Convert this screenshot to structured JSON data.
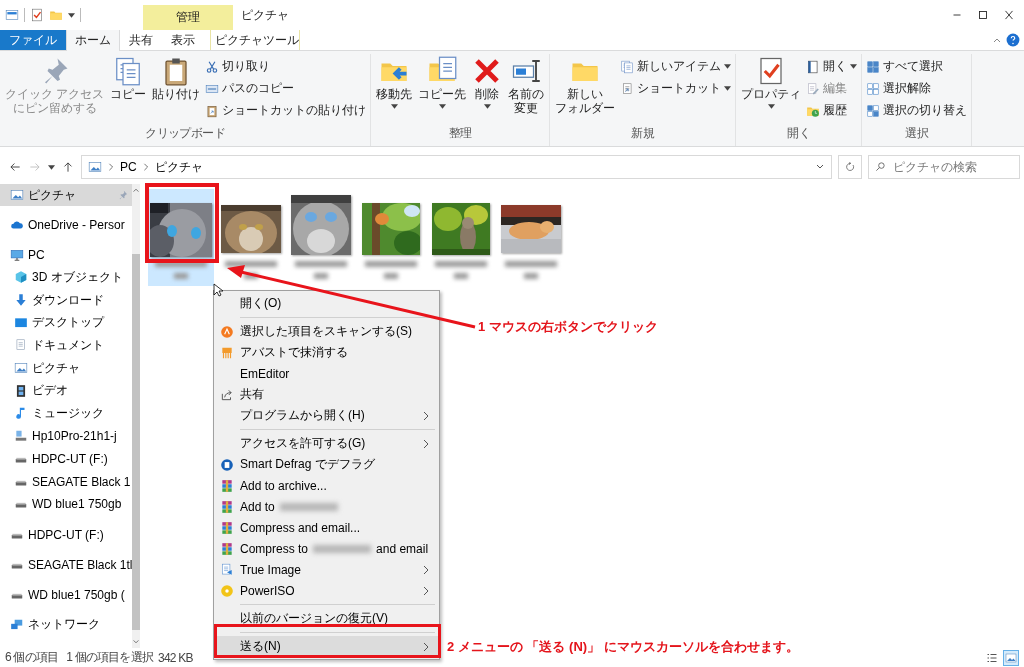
{
  "title_bar": {
    "contextual_tab_group": "管理",
    "title": "ピクチャ"
  },
  "ribbon_tabs": [
    {
      "label": "ファイル",
      "kind": "file",
      "selected": false
    },
    {
      "label": "ホーム",
      "kind": "normal",
      "selected": true
    },
    {
      "label": "共有",
      "kind": "normal",
      "selected": false
    },
    {
      "label": "表示",
      "kind": "normal",
      "selected": false
    },
    {
      "label": "ピクチャツール",
      "kind": "contextual",
      "selected": false
    }
  ],
  "ribbon_groups": [
    {
      "name": "クリップボード",
      "commands": [
        {
          "lines": [
            "クイック アクセス",
            "にピン留めする"
          ],
          "kind": "large",
          "dropdown": false,
          "disabled": true
        },
        {
          "label": "コピー",
          "kind": "large",
          "dropdown": false,
          "disabled": false
        },
        {
          "label": "貼り付け",
          "kind": "large",
          "dropdown": false,
          "disabled": false
        },
        {
          "label": "切り取り",
          "kind": "small",
          "dropdown": false,
          "disabled": false
        },
        {
          "label": "パスのコピー",
          "kind": "small",
          "dropdown": false,
          "disabled": false
        },
        {
          "label": "ショートカットの貼り付け",
          "kind": "small",
          "dropdown": false,
          "disabled": false
        }
      ]
    },
    {
      "name": "整理",
      "commands": [
        {
          "label": "移動先",
          "kind": "large",
          "dropdown": true,
          "disabled": false
        },
        {
          "label": "コピー先",
          "kind": "large",
          "dropdown": true,
          "disabled": false
        },
        {
          "label": "削除",
          "kind": "large",
          "dropdown": true,
          "disabled": false
        },
        {
          "lines": [
            "名前の",
            "変更"
          ],
          "kind": "large",
          "dropdown": false,
          "disabled": false
        }
      ]
    },
    {
      "name": "新規",
      "commands": [
        {
          "lines": [
            "新しい",
            "フォルダー"
          ],
          "kind": "large",
          "dropdown": false,
          "disabled": false
        },
        {
          "label": "新しいアイテム",
          "kind": "small",
          "dropdown": true,
          "disabled": false
        },
        {
          "label": "ショートカット",
          "kind": "small",
          "dropdown": true,
          "disabled": false
        }
      ]
    },
    {
      "name": "開く",
      "commands": [
        {
          "label": "プロパティ",
          "kind": "large",
          "dropdown": true,
          "disabled": false
        },
        {
          "label": "開く",
          "kind": "small",
          "dropdown": true,
          "disabled": false
        },
        {
          "label": "編集",
          "kind": "small",
          "dropdown": false,
          "disabled": true
        },
        {
          "label": "履歴",
          "kind": "small",
          "dropdown": false,
          "disabled": false
        }
      ]
    },
    {
      "name": "選択",
      "commands": [
        {
          "label": "すべて選択",
          "kind": "small",
          "dropdown": false,
          "disabled": false
        },
        {
          "label": "選択解除",
          "kind": "small",
          "dropdown": false,
          "disabled": false
        },
        {
          "label": "選択の切り替え",
          "kind": "small",
          "dropdown": false,
          "disabled": false
        }
      ]
    }
  ],
  "address_bar": {
    "path": [
      "PC",
      "ピクチャ"
    ],
    "search_placeholder": "ピクチャの検索"
  },
  "sidebar": {
    "items": [
      {
        "label": "ピクチャ",
        "kind": "pictures",
        "selected": true,
        "pinned": true
      },
      {
        "label": "OneDrive - Persor",
        "kind": "onedrive",
        "selected": false,
        "pinned": false
      },
      {
        "label": "PC",
        "kind": "pc",
        "selected": false,
        "pinned": false,
        "children": [
          {
            "label": "3D オブジェクト",
            "kind": "objects3d",
            "selected": false,
            "pinned": false
          },
          {
            "label": "ダウンロード",
            "kind": "downloads",
            "selected": false,
            "pinned": false
          },
          {
            "label": "デスクトップ",
            "kind": "desktop",
            "selected": false,
            "pinned": false
          },
          {
            "label": "ドキュメント",
            "kind": "documents",
            "selected": false,
            "pinned": false
          },
          {
            "label": "ピクチャ",
            "kind": "pictures",
            "selected": false,
            "pinned": false
          },
          {
            "label": "ビデオ",
            "kind": "videos",
            "selected": false,
            "pinned": false
          },
          {
            "label": "ミュージック",
            "kind": "music",
            "selected": false,
            "pinned": false
          },
          {
            "label": "Hp10Pro-21h1-j",
            "kind": "netpc",
            "selected": false,
            "pinned": false
          },
          {
            "label": "HDPC-UT (F:)",
            "kind": "drive",
            "selected": false,
            "pinned": false
          },
          {
            "label": "SEAGATE Black 1",
            "kind": "drive",
            "selected": false,
            "pinned": false
          },
          {
            "label": "WD blue1 750gb",
            "kind": "drive",
            "selected": false,
            "pinned": false
          }
        ]
      },
      {
        "label": "HDPC-UT (F:)",
        "kind": "drive",
        "selected": false,
        "pinned": false
      },
      {
        "label": "SEAGATE Black 1tl",
        "kind": "drive",
        "selected": false,
        "pinned": false
      },
      {
        "label": "WD blue1 750gb (",
        "kind": "drive",
        "selected": false,
        "pinned": false
      },
      {
        "label": "ネットワーク",
        "kind": "network",
        "selected": false,
        "pinned": false
      }
    ]
  },
  "files": [
    {
      "kind": "picture",
      "selected": true
    },
    {
      "kind": "picture",
      "selected": false
    },
    {
      "kind": "picture",
      "selected": false
    },
    {
      "kind": "picture",
      "selected": false
    },
    {
      "kind": "picture",
      "selected": false
    },
    {
      "kind": "picture",
      "selected": false
    }
  ],
  "context_menu": {
    "sections": [
      [
        {
          "label": "開く(O)",
          "kind": "plain",
          "submenu": false,
          "selected": false,
          "redacted": false
        }
      ],
      [
        {
          "label": "選択した項目をスキャンする(S)",
          "kind": "avast",
          "submenu": false,
          "selected": false,
          "redacted": false
        },
        {
          "label": "アバストで抹消する",
          "kind": "shred",
          "submenu": false,
          "selected": false,
          "redacted": false
        },
        {
          "label": "EmEditor",
          "kind": "plain",
          "submenu": false,
          "selected": false,
          "redacted": false
        },
        {
          "label": "共有",
          "kind": "share",
          "submenu": false,
          "selected": false,
          "redacted": false
        },
        {
          "label": "プログラムから開く(H)",
          "kind": "plain",
          "submenu": true,
          "selected": false,
          "redacted": false
        }
      ],
      [
        {
          "label": "アクセスを許可する(G)",
          "kind": "plain",
          "submenu": true,
          "selected": false,
          "redacted": false
        },
        {
          "label": "Smart Defrag でデフラグ",
          "kind": "defrag",
          "submenu": false,
          "selected": false,
          "redacted": false
        },
        {
          "label": "Add to archive...",
          "kind": "archive",
          "submenu": false,
          "selected": false,
          "redacted": false
        },
        {
          "label": "Add to",
          "kind": "archive",
          "submenu": false,
          "selected": false,
          "redacted": true
        },
        {
          "label": "Compress and email...",
          "kind": "archive",
          "submenu": false,
          "selected": false,
          "redacted": false
        },
        {
          "label": "Compress to",
          "label_after": "and email",
          "kind": "archive",
          "submenu": false,
          "selected": false,
          "redacted": true
        },
        {
          "label": "True Image",
          "kind": "backup",
          "submenu": true,
          "selected": false,
          "redacted": false
        },
        {
          "label": "PowerISO",
          "kind": "disc",
          "submenu": true,
          "selected": false,
          "redacted": false
        }
      ],
      [
        {
          "label": "以前のバージョンの復元(V)",
          "kind": "plain",
          "submenu": false,
          "selected": false,
          "redacted": false
        }
      ],
      [
        {
          "label": "送る(N)",
          "kind": "plain",
          "submenu": true,
          "selected": true,
          "redacted": false
        }
      ]
    ]
  },
  "annotations": [
    {
      "text": "1 マウスの右ボタンでクリック"
    },
    {
      "text": "2 メニューの 「送る (N)」 にマウスカーソルを合わせます。"
    }
  ],
  "status_bar": {
    "item_count": "6 個の項目",
    "selection": "1 個の項目を選択",
    "size": "342 KB",
    "views": [
      {
        "kind": "details",
        "selected": false
      },
      {
        "kind": "thumbnails",
        "selected": true
      }
    ]
  }
}
